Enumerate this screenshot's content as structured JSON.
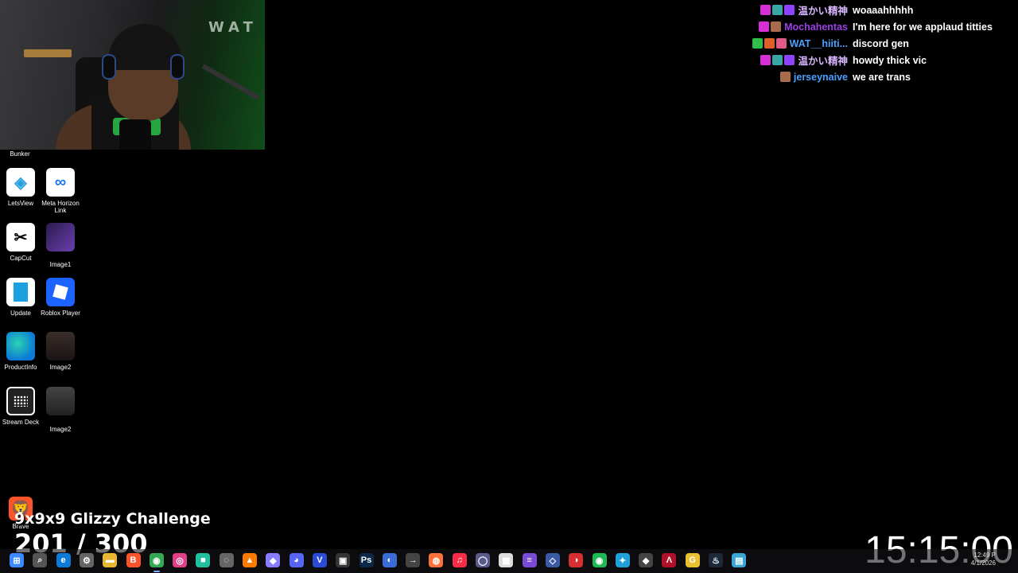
{
  "webcam": {
    "sign_text": "WAT"
  },
  "desktop": {
    "bunker_label": "Bunker",
    "icons": [
      {
        "label": "LetsView",
        "glyph": "◈"
      },
      {
        "label": "Meta Horizon Link",
        "glyph": "∞"
      },
      {
        "label": "CapCut",
        "glyph": "✂"
      },
      {
        "label": "Image1",
        "glyph": ""
      },
      {
        "label": "Update",
        "glyph": ""
      },
      {
        "label": "Roblox Player",
        "glyph": ""
      },
      {
        "label": "ProductInfo",
        "glyph": ""
      },
      {
        "label": "Image2",
        "glyph": ""
      },
      {
        "label": "Stream Deck",
        "glyph": ""
      },
      {
        "label": "Image2",
        "glyph": ""
      },
      {
        "label": "Brave",
        "glyph": "🦁"
      }
    ]
  },
  "chat": {
    "messages": [
      {
        "user": "温かい精神",
        "message": "woaaahhhhh",
        "color": "#d7b6ff",
        "badges": [
          "#d62fd6",
          "#3aa6a6",
          "#8e44ff"
        ]
      },
      {
        "user": "Mochahentas",
        "message": "I'm here for we applaud titties",
        "color": "#9b3fe8",
        "badges": [
          "#d62fd6",
          "#a86b4d"
        ]
      },
      {
        "user": "WAT__hiiti...",
        "message": "discord gen",
        "color": "#4aa0ff",
        "badges": [
          "#2fbf4a",
          "#e0602a",
          "#e05a8a"
        ]
      },
      {
        "user": "温かい精神",
        "message": "howdy thick vic",
        "color": "#d7b6ff",
        "badges": [
          "#d62fd6",
          "#3aa6a6",
          "#8e44ff"
        ]
      },
      {
        "user": "jerseynaive",
        "message": "we are trans",
        "color": "#4aa0ff",
        "badges": [
          "#a86b4d"
        ]
      }
    ]
  },
  "challenge": {
    "title": "9x9x9 Glizzy Challenge",
    "count": "201 / 300",
    "progress_current": 201,
    "progress_total": 300
  },
  "clock": {
    "big": "15:15:00"
  },
  "taskbar": {
    "icons": [
      {
        "name": "start",
        "glyph": "⊞",
        "color": "#3a8bff"
      },
      {
        "name": "search",
        "glyph": "⌕",
        "color": "#555"
      },
      {
        "name": "edge",
        "glyph": "e",
        "color": "#0c7ad6"
      },
      {
        "name": "settings",
        "glyph": "⚙",
        "color": "#666"
      },
      {
        "name": "file-explorer",
        "glyph": "▬",
        "color": "#e8b730"
      },
      {
        "name": "brave",
        "glyph": "B",
        "color": "#fb542b"
      },
      {
        "name": "chrome",
        "glyph": "◉",
        "color": "#34a853"
      },
      {
        "name": "app-pink",
        "glyph": "◎",
        "color": "#e0408a"
      },
      {
        "name": "app-teal",
        "glyph": "■",
        "color": "#1fbf9f"
      },
      {
        "name": "app-gray",
        "glyph": "◌",
        "color": "#666"
      },
      {
        "name": "app-orange",
        "glyph": "▲",
        "color": "#ff7a00"
      },
      {
        "name": "gamepad",
        "glyph": "◆",
        "color": "#8a7cff"
      },
      {
        "name": "discord",
        "glyph": "◕",
        "color": "#5865f2"
      },
      {
        "name": "vegas",
        "glyph": "V",
        "color": "#2a4bd6"
      },
      {
        "name": "obs",
        "glyph": "▣",
        "color": "#333"
      },
      {
        "name": "photoshop",
        "glyph": "Ps",
        "color": "#0b2a4a"
      },
      {
        "name": "app-blue",
        "glyph": "◐",
        "color": "#3a6bd6"
      },
      {
        "name": "app-arrow",
        "glyph": "→",
        "color": "#444"
      },
      {
        "name": "firefox",
        "glyph": "◍",
        "color": "#ff7139"
      },
      {
        "name": "music",
        "glyph": "♫",
        "color": "#fa2d48"
      },
      {
        "name": "app-circle",
        "glyph": "◯",
        "color": "#5a5a8a"
      },
      {
        "name": "app-white",
        "glyph": "▦",
        "color": "#ddd"
      },
      {
        "name": "app-purple",
        "glyph": "≡",
        "color": "#7a4bd6"
      },
      {
        "name": "app-diamond",
        "glyph": "◇",
        "color": "#3a5aa6"
      },
      {
        "name": "app-red",
        "glyph": "◑",
        "color": "#d62f2f"
      },
      {
        "name": "spotify",
        "glyph": "◉",
        "color": "#1db954"
      },
      {
        "name": "app-cyan",
        "glyph": "✦",
        "color": "#1fa0d6"
      },
      {
        "name": "app-dark",
        "glyph": "◆",
        "color": "#444"
      },
      {
        "name": "app-crimson",
        "glyph": "Λ",
        "color": "#b0102a"
      },
      {
        "name": "app-yellow",
        "glyph": "G",
        "color": "#e8c030"
      },
      {
        "name": "steam",
        "glyph": "♨",
        "color": "#1b2838"
      },
      {
        "name": "notepad",
        "glyph": "▤",
        "color": "#3aa6d6"
      }
    ],
    "tray_time": "12:49 P",
    "tray_date": "4/1/2026"
  }
}
